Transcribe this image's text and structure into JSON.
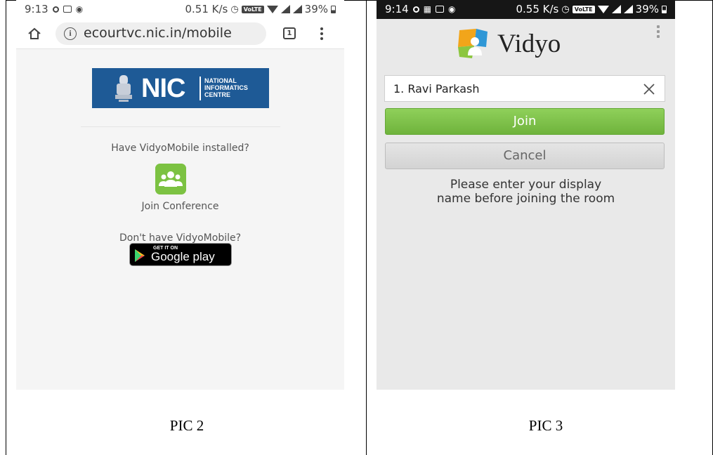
{
  "pic2": {
    "statusbar": {
      "time": "9:13",
      "net_speed": "0.51 K/s",
      "volte": "VoLTE",
      "battery": "39%"
    },
    "browser": {
      "url": "ecourtvc.nic.in/mobile",
      "tab_count": "1"
    },
    "nic_logo": {
      "letters": "NIC",
      "caption": "NATIONAL\nINFORMATICS\nCENTRE"
    },
    "have_installed_text": "Have VidyoMobile installed?",
    "join_conference_label": "Join Conference",
    "dont_have_text": "Don't have VidyoMobile?",
    "play_badge": {
      "small": "GET IT ON",
      "big": "Google play"
    }
  },
  "pic3": {
    "statusbar": {
      "time": "9:14",
      "net_speed": "0.55 K/s",
      "volte": "VoLTE",
      "battery": "39%"
    },
    "logo_text": "Vidyo",
    "display_name_value": "1. Ravi Parkash",
    "join_label": "Join",
    "cancel_label": "Cancel",
    "prompt": "Please enter your display\nname before joining the room"
  },
  "captions": {
    "left": "PIC 2",
    "right": "PIC 3"
  },
  "colors": {
    "nic_blue": "#1e5a96",
    "vidyo_green": "#7cc242",
    "join_green": "#76b840"
  }
}
